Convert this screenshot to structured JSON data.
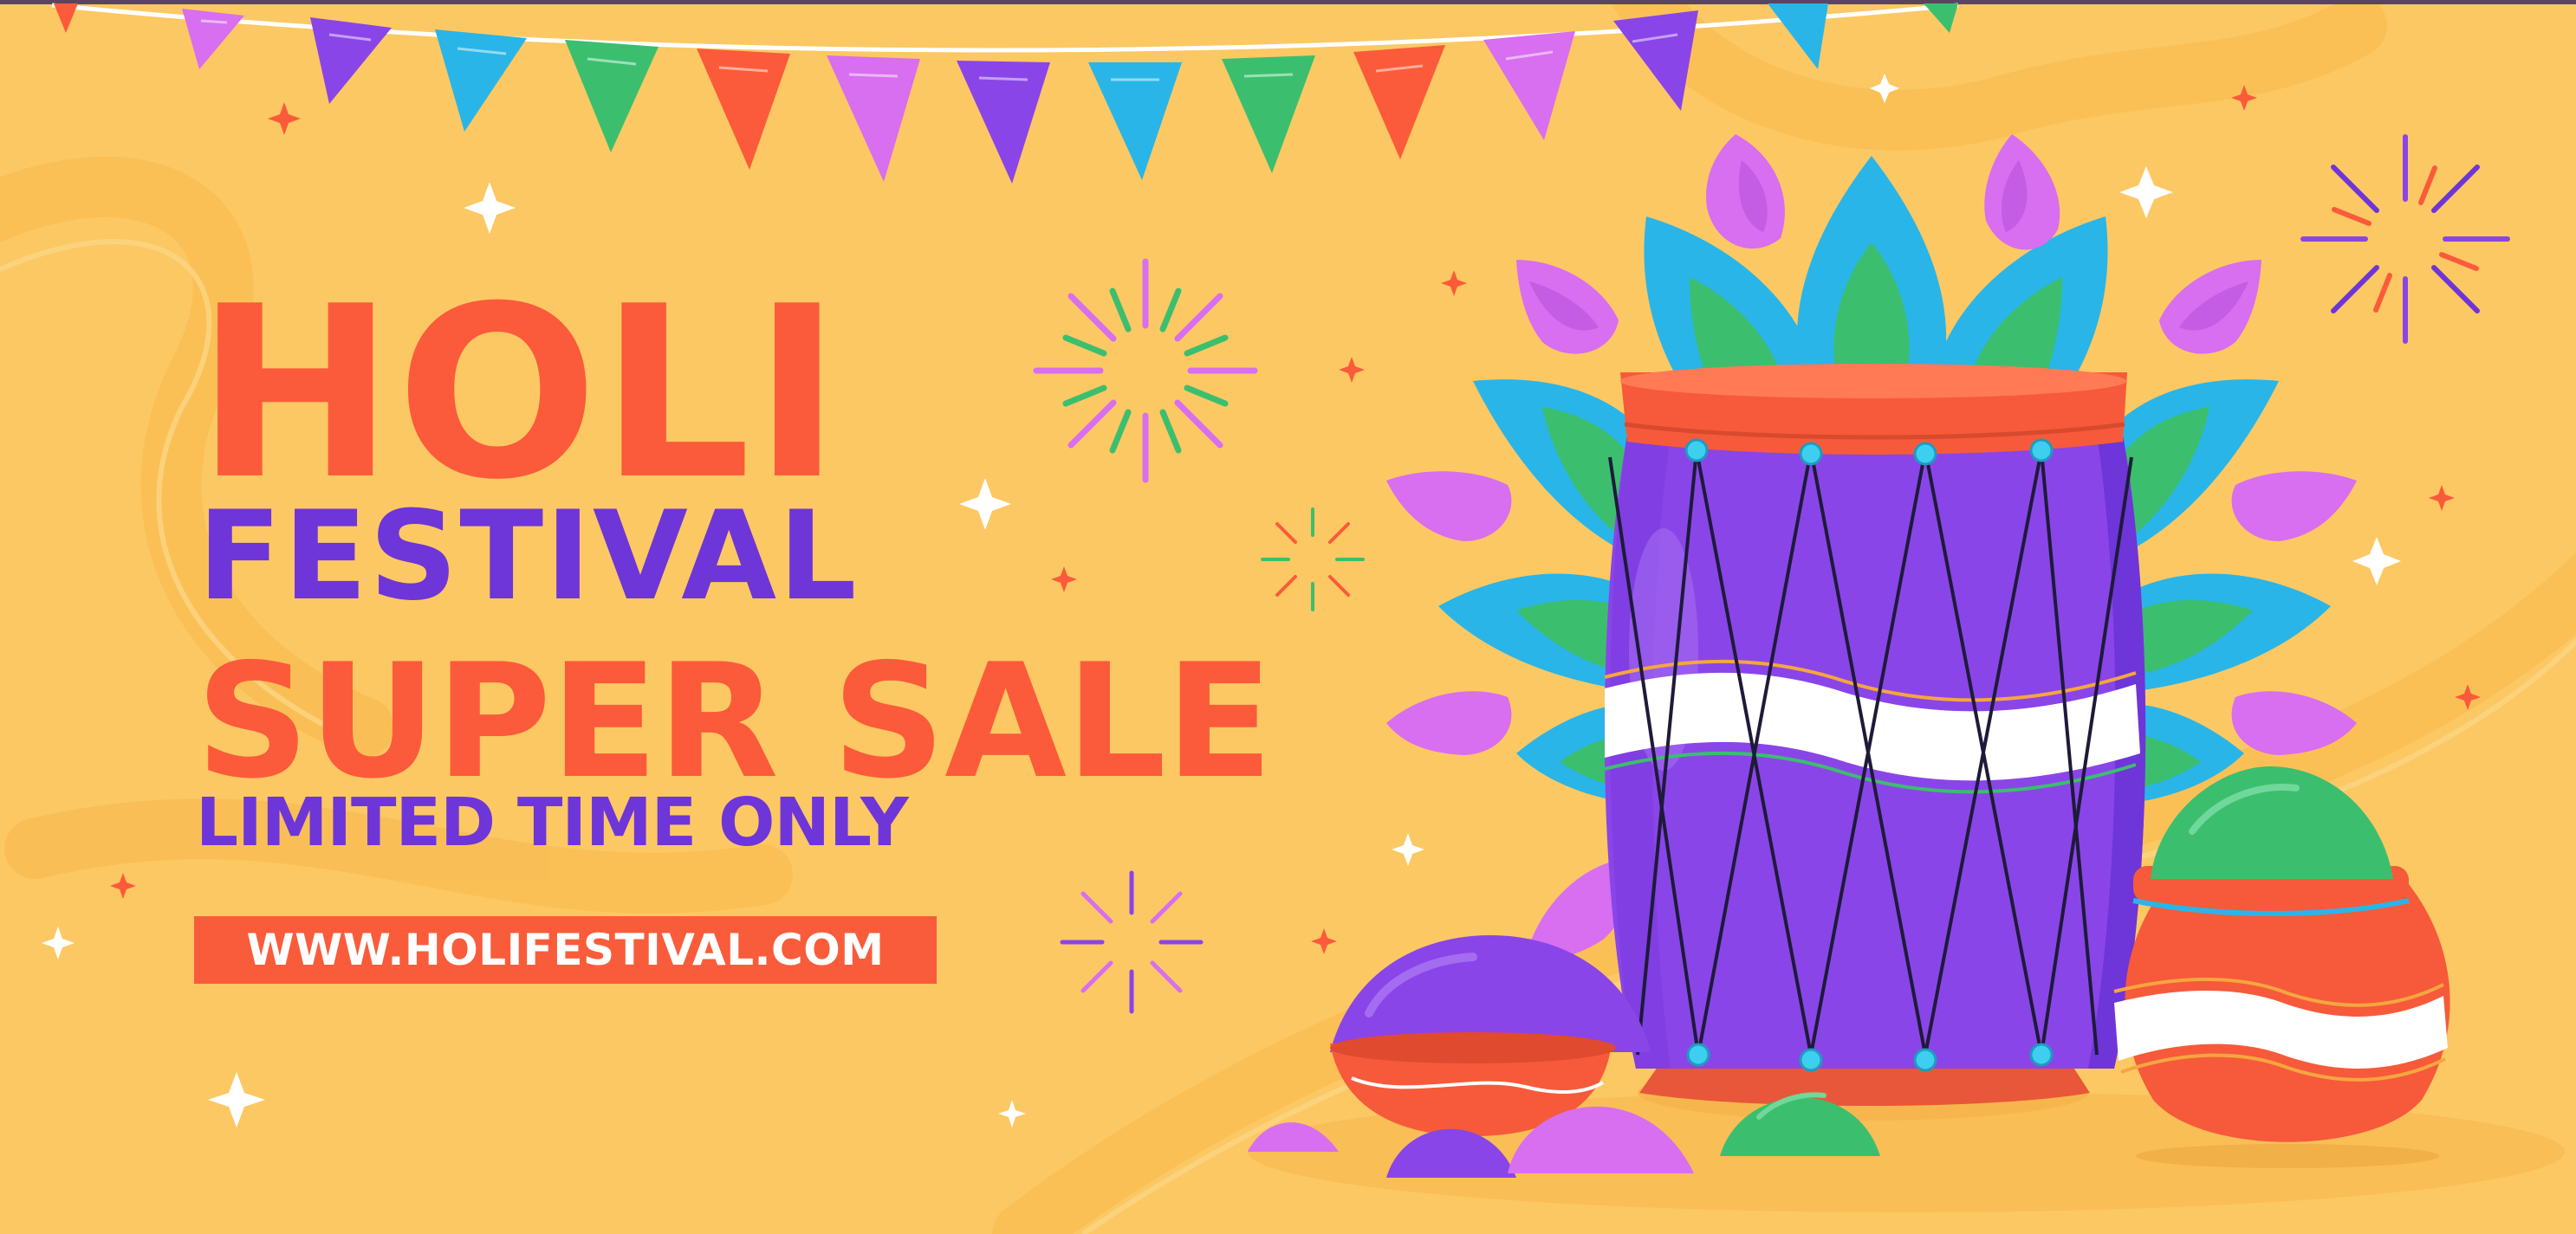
{
  "banner": {
    "title": "HOLI",
    "subtitle": "FESTIVAL",
    "headline": "SUPER SALE",
    "tagline": "LIMITED TIME ONLY",
    "url": "WWW.HOLIFESTIVAL.COM"
  },
  "colors": {
    "background": "#fcc863",
    "orange": "#fb5b3a",
    "purple": "#6e35d8",
    "violet": "#8a45e8",
    "cyan": "#29b5e8",
    "green": "#3bbf6e",
    "pink": "#d86ef0",
    "white": "#ffffff"
  },
  "icons": [
    "bunting-flags",
    "sparkle-icon",
    "firework-icon",
    "leaf-mandala",
    "dhol-drum",
    "color-powder-bowl",
    "color-powder-pile",
    "clay-pot"
  ]
}
